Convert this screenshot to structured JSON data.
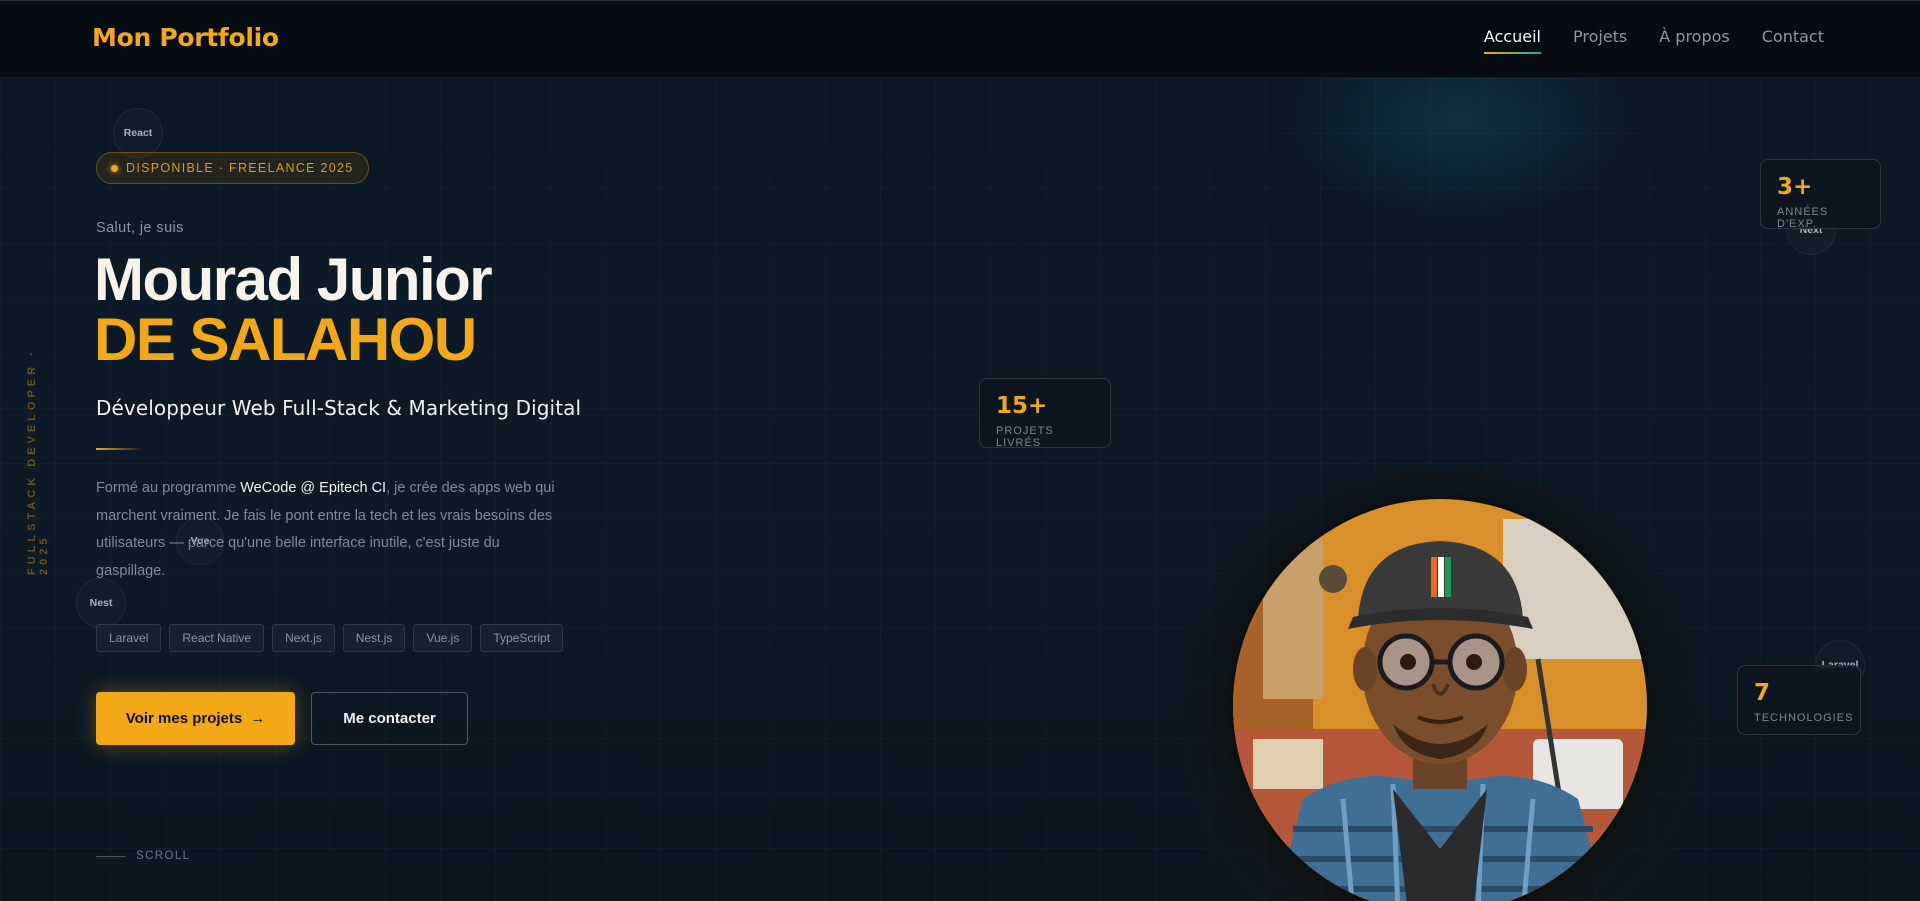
{
  "nav": {
    "brand": "Mon Portfolio",
    "links": [
      {
        "label": "Accueil",
        "active": true
      },
      {
        "label": "Projets",
        "active": false
      },
      {
        "label": "À propos",
        "active": false
      },
      {
        "label": "Contact",
        "active": false
      }
    ]
  },
  "hero": {
    "vertical_text": "FULLSTACK DEVELOPER · 2025",
    "badge": "DISPONIBLE · FREELANCE 2025",
    "greeting": "Salut, je suis",
    "name_line1": "Mourad Junior",
    "name_line2": "DE SALAHOU",
    "role": "Développeur Web Full-Stack & Marketing Digital",
    "bio_before": "Formé au programme ",
    "bio_highlight": "WeCode @ Epitech CI",
    "bio_after": ", je crée des apps web qui marchent vraiment. Je fais le pont entre la tech et les vrais besoins des utilisateurs — parce qu'une belle interface inutile, c'est juste du gaspillage.",
    "chips": [
      "Laravel",
      "React Native",
      "Next.js",
      "Nest.js",
      "Vue.js",
      "TypeScript"
    ],
    "primary_button": "Voir mes projets",
    "primary_arrow": "→",
    "secondary_button": "Me contacter",
    "scroll": "SCROLL"
  },
  "bubbles": [
    "React",
    "Vue",
    "Nest",
    "Next",
    "Laravel"
  ],
  "stats": [
    {
      "value": "15+",
      "label": "PROJETS LIVRÉS"
    },
    {
      "value": "3+",
      "label": "ANNÉES D'EXP."
    },
    {
      "value": "7",
      "label": "TECHNOLOGIES"
    }
  ],
  "colors": {
    "accent": "#f2a817",
    "teal": "#17a89a",
    "background": "#0c1724",
    "nav_bg": "#070b12"
  }
}
